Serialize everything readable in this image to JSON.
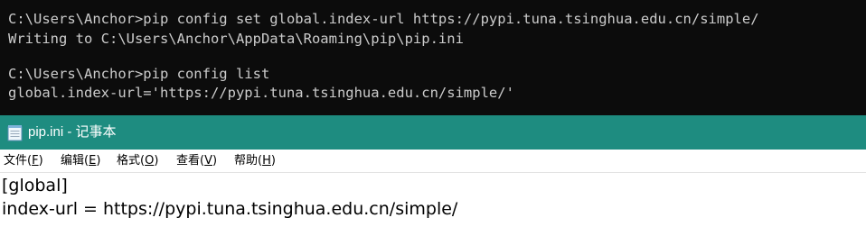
{
  "console": {
    "lines": [
      "C:\\Users\\Anchor>pip config set global.index-url https://pypi.tuna.tsinghua.edu.cn/simple/",
      "Writing to C:\\Users\\Anchor\\AppData\\Roaming\\pip\\pip.ini",
      "",
      "C:\\Users\\Anchor>pip config list",
      "global.index-url='https://pypi.tuna.tsinghua.edu.cn/simple/'"
    ]
  },
  "notepad": {
    "title": "pip.ini - 记事本",
    "icon": "notepad-icon",
    "accent": "#1e8c80",
    "menu": [
      {
        "label": "文件",
        "hotkey": "F"
      },
      {
        "label": "编辑",
        "hotkey": "E"
      },
      {
        "label": "格式",
        "hotkey": "O"
      },
      {
        "label": "查看",
        "hotkey": "V"
      },
      {
        "label": "帮助",
        "hotkey": "H"
      }
    ],
    "content": [
      "[global]",
      "index-url = https://pypi.tuna.tsinghua.edu.cn/simple/"
    ]
  }
}
